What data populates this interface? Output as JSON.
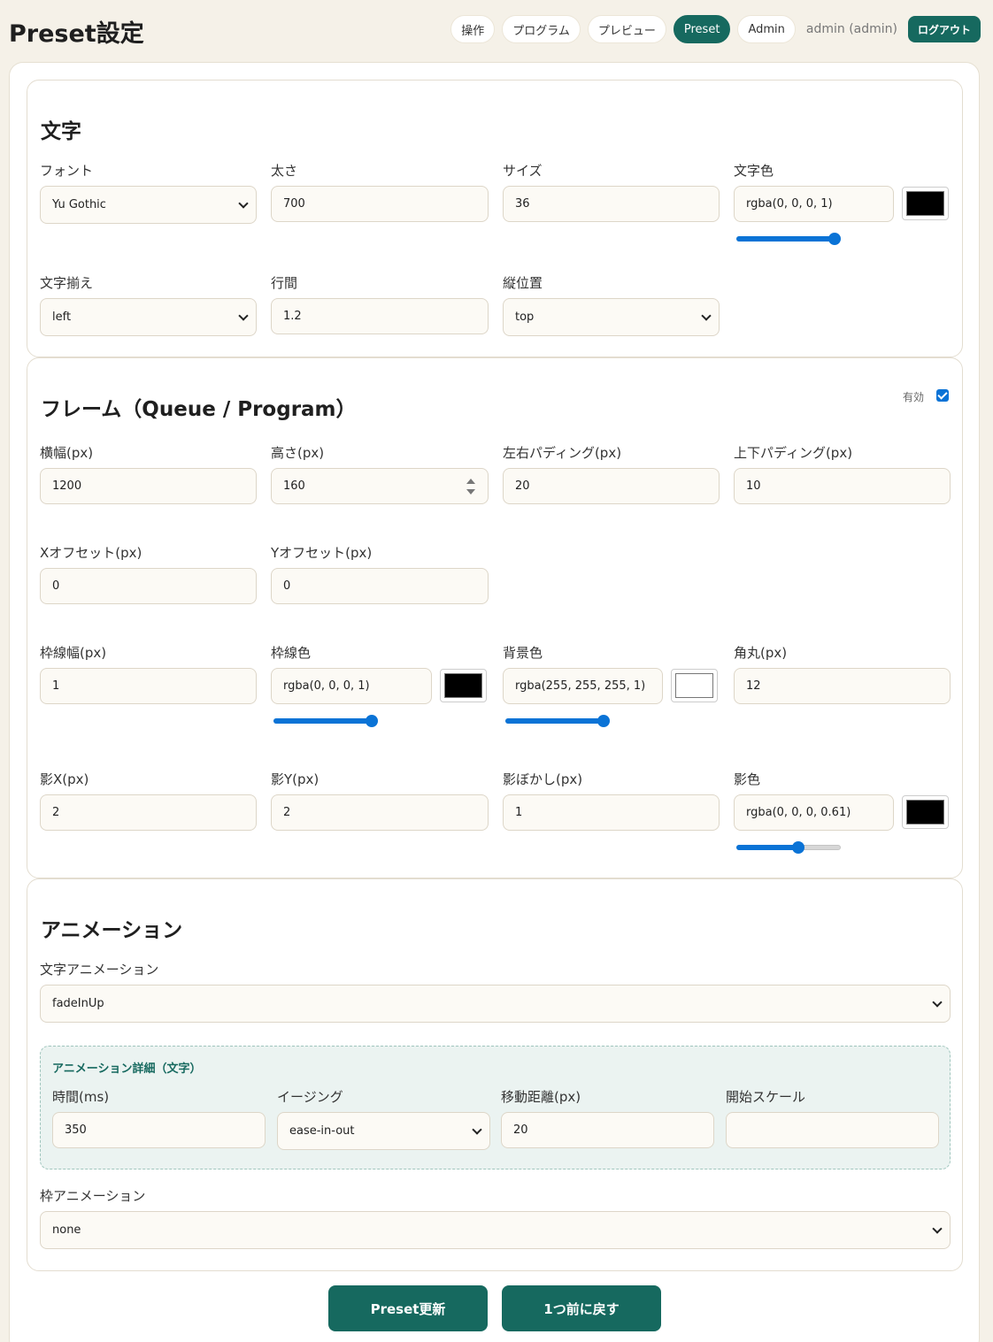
{
  "header": {
    "title": "Preset設定",
    "nav": [
      {
        "label": "操作"
      },
      {
        "label": "プログラム"
      },
      {
        "label": "プレビュー"
      },
      {
        "label": "Preset",
        "active": true
      },
      {
        "label": "Admin"
      }
    ],
    "user": "admin (admin)",
    "logout_label": "ログアウト"
  },
  "text_section": {
    "title": "文字",
    "font": {
      "label": "フォント",
      "value": "Yu Gothic"
    },
    "weight": {
      "label": "太さ",
      "value": "700"
    },
    "size": {
      "label": "サイズ",
      "value": "36"
    },
    "color": {
      "label": "文字色",
      "value": "rgba(0, 0, 0, 1)",
      "swatch": "#000000",
      "alpha": 1
    },
    "align": {
      "label": "文字揃え",
      "value": "left"
    },
    "line_height": {
      "label": "行間",
      "value": "1.2"
    },
    "vertical": {
      "label": "縦位置",
      "value": "top"
    }
  },
  "frame_section": {
    "title": "フレーム（Queue / Program）",
    "enabled_label": "有効",
    "enabled": true,
    "width": {
      "label": "横幅(px)",
      "value": "1200"
    },
    "height": {
      "label": "高さ(px)",
      "value": "160"
    },
    "pad_x": {
      "label": "左右パディング(px)",
      "value": "20"
    },
    "pad_y": {
      "label": "上下パディング(px)",
      "value": "10"
    },
    "offset_x": {
      "label": "Xオフセット(px)",
      "value": "0"
    },
    "offset_y": {
      "label": "Yオフセット(px)",
      "value": "0"
    },
    "border_width": {
      "label": "枠線幅(px)",
      "value": "1"
    },
    "border_color": {
      "label": "枠線色",
      "value": "rgba(0, 0, 0, 1)",
      "swatch": "#000000",
      "alpha": 1
    },
    "bg_color": {
      "label": "背景色",
      "value": "rgba(255, 255, 255, 1)",
      "swatch": "#ffffff",
      "alpha": 1
    },
    "radius": {
      "label": "角丸(px)",
      "value": "12"
    },
    "shadow_x": {
      "label": "影X(px)",
      "value": "2"
    },
    "shadow_y": {
      "label": "影Y(px)",
      "value": "2"
    },
    "shadow_blur": {
      "label": "影ぼかし(px)",
      "value": "1"
    },
    "shadow_color": {
      "label": "影色",
      "value": "rgba(0, 0, 0, 0.61)",
      "swatch": "#000000",
      "alpha": 0.61
    }
  },
  "animation_section": {
    "title": "アニメーション",
    "text_anim": {
      "label": "文字アニメーション",
      "value": "fadeInUp"
    },
    "detail": {
      "title": "アニメーション詳細（文字）",
      "duration": {
        "label": "時間(ms)",
        "value": "350"
      },
      "easing": {
        "label": "イージング",
        "value": "ease-in-out"
      },
      "distance": {
        "label": "移動距離(px)",
        "value": "20"
      },
      "start_scale": {
        "label": "開始スケール",
        "value": ""
      }
    },
    "frame_anim": {
      "label": "枠アニメーション",
      "value": "none"
    }
  },
  "actions": {
    "update_label": "Preset更新",
    "revert_label": "1つ前に戻す"
  },
  "colors": {
    "accent": "#16695f",
    "slider": "#0a73d6",
    "background": "#f5f1e8"
  }
}
